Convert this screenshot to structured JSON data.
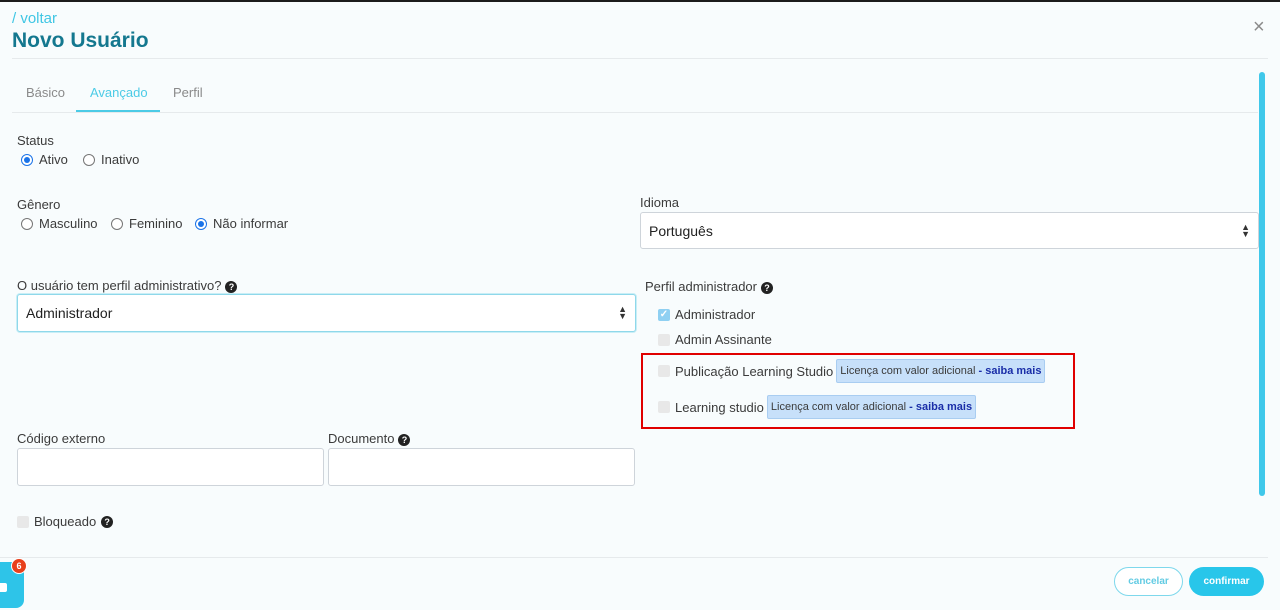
{
  "header": {
    "back_link": "/ voltar",
    "title": "Novo Usuário",
    "close_symbol": "×"
  },
  "tabs": [
    {
      "label": "Básico",
      "active": false
    },
    {
      "label": "Avançado",
      "active": true
    },
    {
      "label": "Perfil",
      "active": false
    }
  ],
  "status": {
    "label": "Status",
    "options": [
      {
        "label": "Ativo",
        "selected": true
      },
      {
        "label": "Inativo",
        "selected": false
      }
    ]
  },
  "genero": {
    "label": "Gênero",
    "options": [
      {
        "label": "Masculino",
        "selected": false
      },
      {
        "label": "Feminino",
        "selected": false
      },
      {
        "label": "Não informar",
        "selected": true
      }
    ]
  },
  "idioma": {
    "label": "Idioma",
    "value": "Português"
  },
  "perfil_admin_question": {
    "label": "O usuário tem perfil administrativo?",
    "value": "Administrador"
  },
  "perfil_administrador": {
    "label": "Perfil administrador",
    "items": [
      {
        "label": "Administrador",
        "checked": true
      },
      {
        "label": "Admin Assinante",
        "checked": false
      },
      {
        "label": "Publicação Learning Studio",
        "checked": false,
        "badge_text": "Licença com valor adicional",
        "badge_link": "- saiba mais"
      },
      {
        "label": "Learning studio",
        "checked": false,
        "badge_text": "Licença com valor adicional",
        "badge_link": "- saiba mais"
      }
    ]
  },
  "codigo_externo": {
    "label": "Código externo",
    "value": ""
  },
  "documento": {
    "label": "Documento",
    "value": ""
  },
  "bloqueado": {
    "label": "Bloqueado",
    "checked": false
  },
  "footer": {
    "cancel_label": "cancelar",
    "confirm_label": "confirmar"
  },
  "chat": {
    "notification_count": "6"
  },
  "colors": {
    "accent": "#28c6ea",
    "title": "#14788f",
    "highlight_box": "#e00000",
    "badge_bg": "#c7e0fa"
  },
  "icons": {
    "help": "question-circle-icon",
    "check": "checkmark-icon",
    "select_caret": "sort-caret-icon",
    "close": "close-icon",
    "chat": "chat-bubble-icon"
  }
}
